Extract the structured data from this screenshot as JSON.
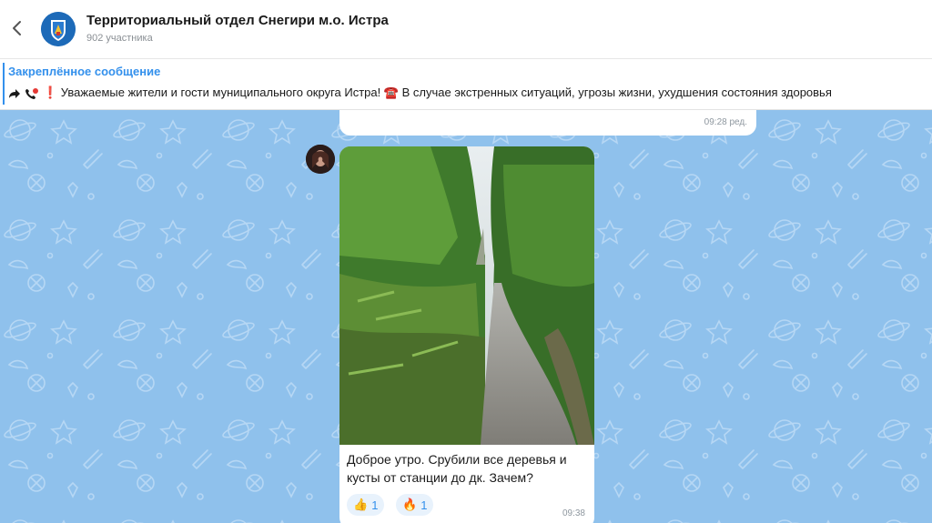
{
  "header": {
    "title": "Территориальный отдел Снегири м.о. Истра",
    "subtitle": "902 участника"
  },
  "pinned": {
    "title": "Закреплённое сообщение",
    "text": "❗ Уважаемые жители и гости муниципального округа Истра!  ☎️ В случае экстренных ситуаций, угрозы жизни, ухудшения состояния здоровья"
  },
  "previous_message": {
    "time": "09:28 ред."
  },
  "message": {
    "text": "Доброе утро. Срубили все деревья и кусты от станции до дк. Зачем?",
    "time": "09:38",
    "reactions": [
      {
        "emoji": "👍",
        "count": "1"
      },
      {
        "emoji": "🔥",
        "count": "1"
      }
    ]
  },
  "colors": {
    "accent": "#3390ec",
    "chat_bg": "#8fc1ec",
    "reaction_bg": "#e8f2fc"
  }
}
